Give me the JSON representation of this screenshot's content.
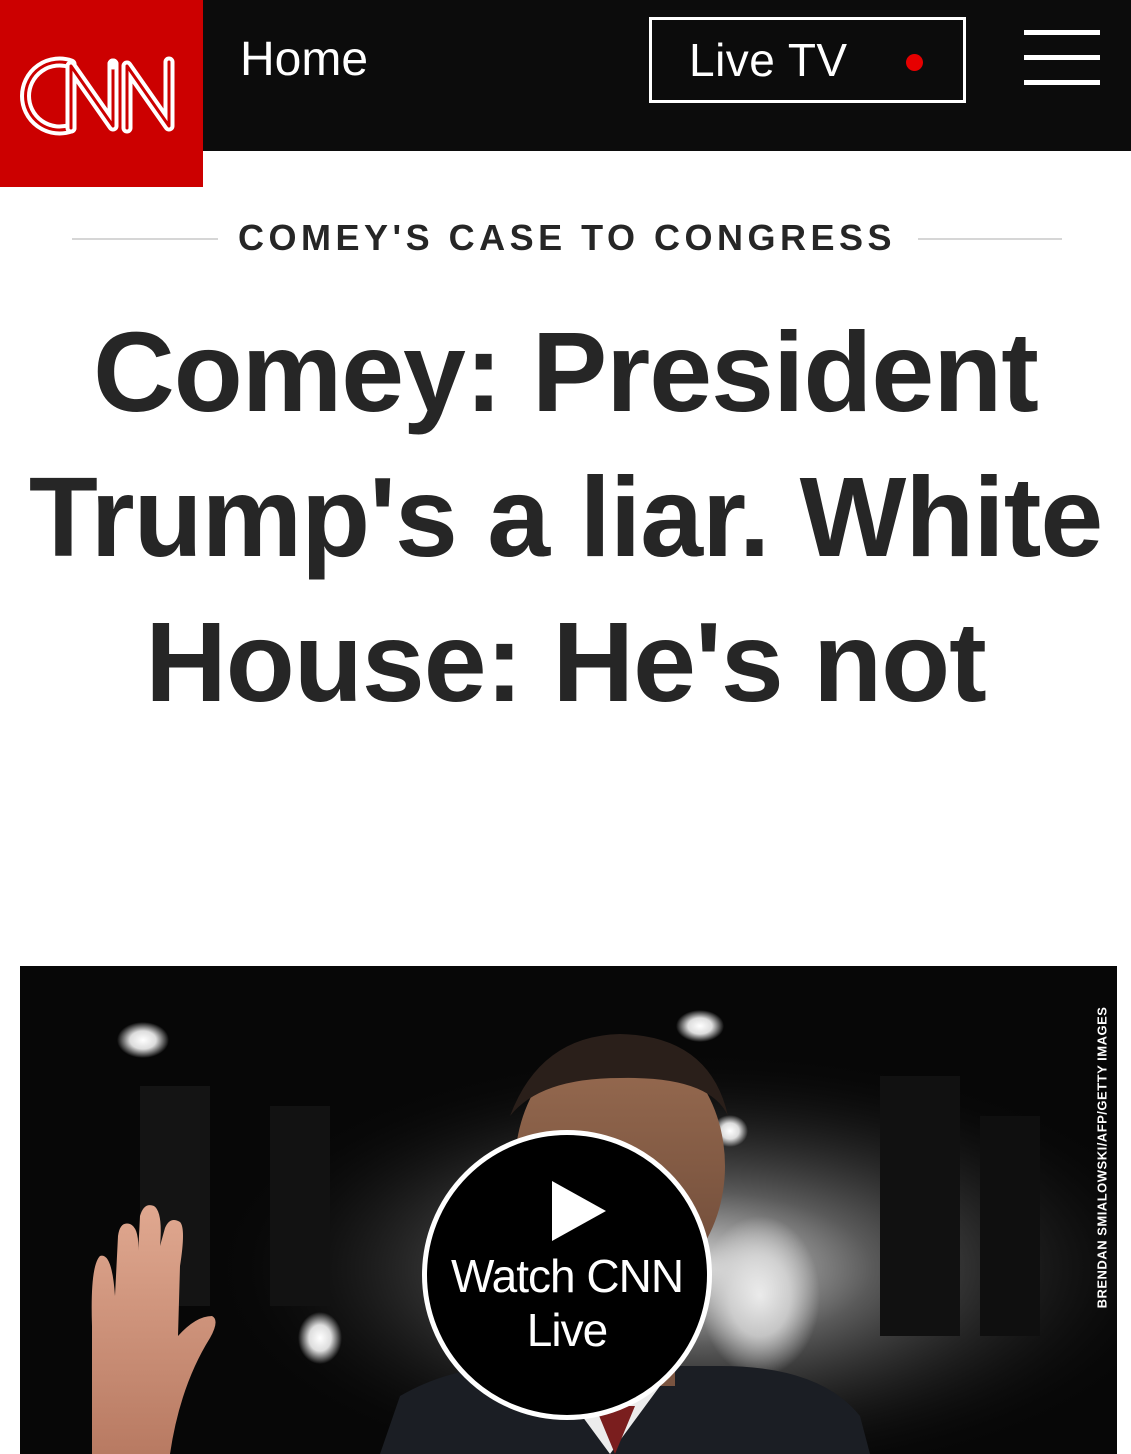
{
  "header": {
    "logo_text": "CNN",
    "home_label": "Home",
    "live_tv_label": "Live TV"
  },
  "article": {
    "kicker": "COMEY'S CASE TO CONGRESS",
    "headline": "Comey: President Trump's a liar. White House: He's not"
  },
  "video": {
    "watch_label": "Watch CNN Live",
    "photo_credit": "BRENDAN SMIALOWSKI/AFP/GETTY IMAGES"
  },
  "colors": {
    "brand_red": "#cc0000",
    "nav_background": "#0c0c0c",
    "live_dot": "#e60000",
    "headline_text": "#262626"
  },
  "icons": [
    "cnn-logo",
    "live-indicator-icon",
    "hamburger-menu-icon",
    "play-icon"
  ]
}
